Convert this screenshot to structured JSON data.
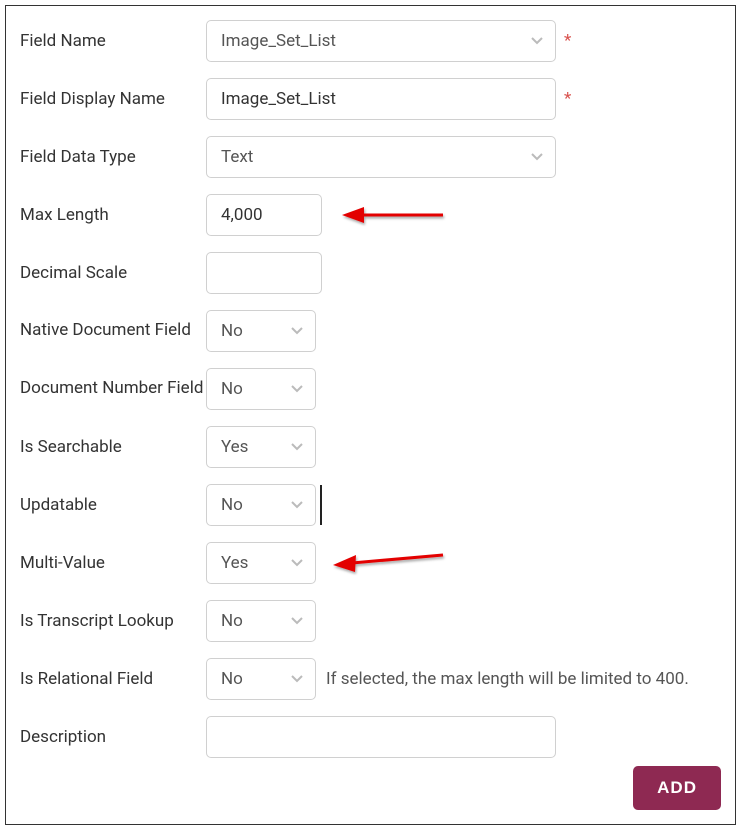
{
  "form": {
    "fieldName": {
      "label": "Field Name",
      "value": "Image_Set_List",
      "required": true
    },
    "fieldDisplayName": {
      "label": "Field Display Name",
      "value": "Image_Set_List",
      "required": true
    },
    "fieldDataType": {
      "label": "Field Data Type",
      "value": "Text"
    },
    "maxLength": {
      "label": "Max Length",
      "value": "4,000"
    },
    "decimalScale": {
      "label": "Decimal Scale",
      "value": ""
    },
    "nativeDocField": {
      "label": "Native Document Field",
      "value": "No"
    },
    "docNumberField": {
      "label": "Document Number Field",
      "value": "No"
    },
    "isSearchable": {
      "label": "Is Searchable",
      "value": "Yes"
    },
    "updatable": {
      "label": "Updatable",
      "value": "No"
    },
    "multiValue": {
      "label": "Multi-Value",
      "value": "Yes"
    },
    "isTranscriptLookup": {
      "label": "Is Transcript Lookup",
      "value": "No"
    },
    "isRelationalField": {
      "label": "Is Relational Field",
      "value": "No",
      "hint": "If selected, the max length will be limited to 400."
    },
    "description": {
      "label": "Description",
      "value": ""
    }
  },
  "buttons": {
    "add": "ADD"
  },
  "required_marker": "*"
}
